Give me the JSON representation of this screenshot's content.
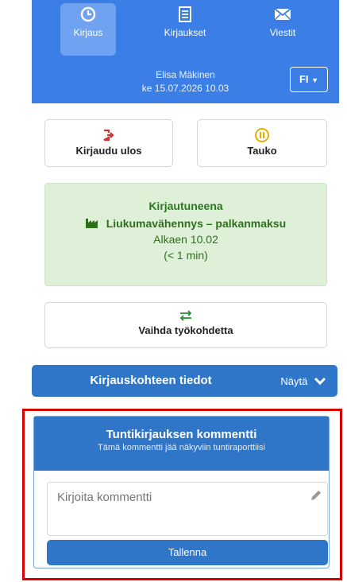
{
  "nav": {
    "tabs": [
      {
        "label": "Kirjaus",
        "icon": "clock-icon",
        "active": true
      },
      {
        "label": "Kirjaukset",
        "icon": "list-icon",
        "active": false
      },
      {
        "label": "Viestit",
        "icon": "mail-icon",
        "active": false
      }
    ],
    "user_name": "Elisa Mäkinen",
    "datetime": "ke 15.07.2026 10.03",
    "language": "FI"
  },
  "actions": {
    "logout_label": "Kirjaudu ulos",
    "pause_label": "Tauko",
    "switch_label": "Vaihda työkohdetta"
  },
  "status": {
    "state": "Kirjautuneena",
    "project": "Liukumavähennys – palkanmaksu",
    "since": "Alkaen 10.02",
    "duration": "(< 1 min)"
  },
  "details_bar": {
    "title": "Kirjauskohteen tiedot",
    "show_label": "Näytä"
  },
  "comment": {
    "title": "Tuntikirjauksen kommentti",
    "subtitle": "Tämä kommentti jää näkyviin tuntiraporttiisi",
    "placeholder": "Kirjoita kommentti",
    "save_label": "Tallenna"
  },
  "colors": {
    "primary": "#3a7ee6",
    "bar": "#2f76c8",
    "success_bg": "#dff0d8",
    "success_text": "#2a7a1d",
    "logout_icon": "#d32f2f",
    "pause_icon": "#e2b100",
    "highlight": "#d50000"
  }
}
